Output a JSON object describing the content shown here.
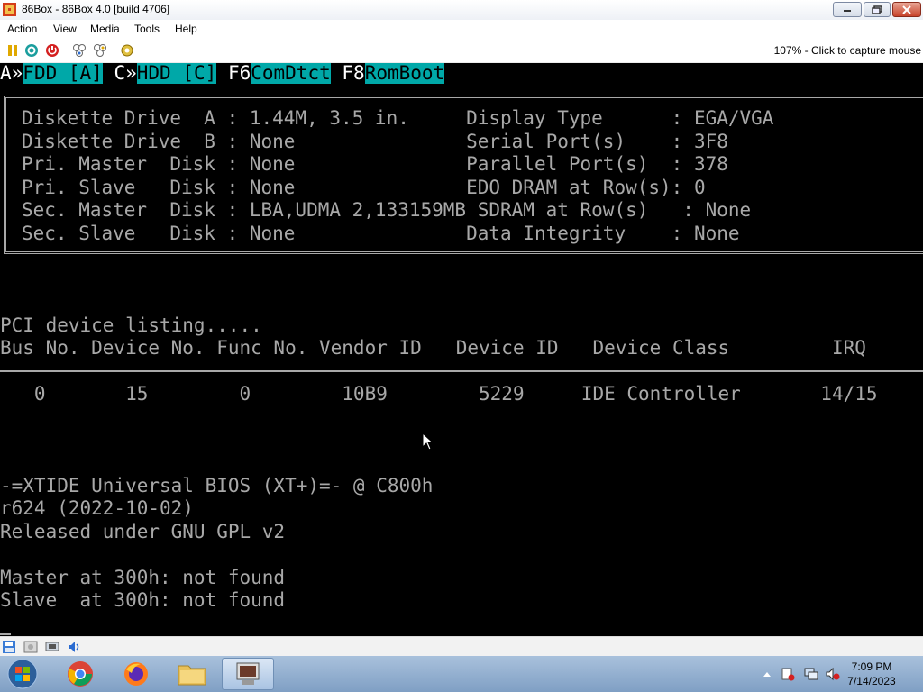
{
  "window": {
    "title": "86Box - 86Box 4.0 [build 4706]"
  },
  "menu": [
    "Action",
    "View",
    "Media",
    "Tools",
    "Help"
  ],
  "toolbar": {
    "icons": [
      "pause-icon",
      "reset-icon",
      "power-icon",
      "ctrl-alt-del-icon",
      "ctrl-alt-esc-icon",
      "settings-icon"
    ],
    "capture_hint": "107% - Click to capture mouse"
  },
  "bios": {
    "hotkeys": {
      "a_prefix": "A»",
      "a_label": "FDD [A]",
      "c_prefix": "C»",
      "c_label": "HDD [C]",
      "f6_key": "F6",
      "f6_label": "ComDtct",
      "f8_key": "F8",
      "f8_label": "RomBoot"
    },
    "config_rows": [
      "Diskette Drive  A : 1.44M, 3.5 in.     Display Type      : EGA/VGA",
      "Diskette Drive  B : None               Serial Port(s)    : 3F8",
      "Pri. Master  Disk : None               Parallel Port(s)  : 378",
      "Pri. Slave   Disk : None               EDO DRAM at Row(s): 0",
      "Sec. Master  Disk : LBA,UDMA 2,133159MB SDRAM at Row(s)   : None",
      "Sec. Slave   Disk : None               Data Integrity    : None"
    ],
    "pci_title": "PCI device listing.....",
    "pci_header": "Bus No. Device No. Func No. Vendor ID   Device ID   Device Class         IRQ",
    "pci_rows": [
      "   0       15        0        10B9        5229     IDE Controller       14/15"
    ],
    "xtide_lines": [
      "-=XTIDE Universal BIOS (XT+)=- @ C800h",
      "r624 (2022-10-02)",
      "Released under GNU GPL v2",
      "",
      "Master at 300h: not found",
      "Slave  at 300h: not found"
    ]
  },
  "statusbar": {
    "icons": [
      "floppy-icon",
      "hdd-icon",
      "network-icon",
      "sound-icon"
    ]
  },
  "taskbar": {
    "apps": [
      "start-button",
      "chrome-icon",
      "firefox-icon",
      "explorer-icon",
      "86box-icon"
    ],
    "time": "7:09 PM",
    "date": "7/14/2023"
  }
}
